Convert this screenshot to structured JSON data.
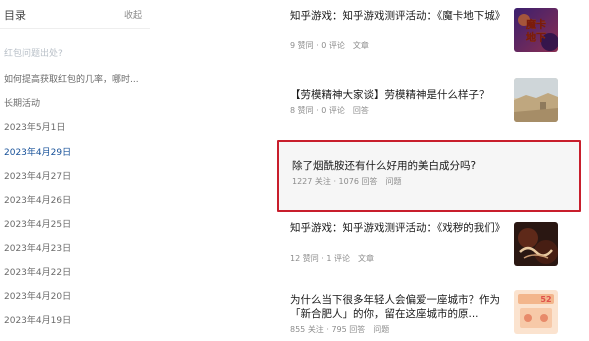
{
  "toc": {
    "title": "目录",
    "collapse_label": "收起",
    "items": [
      {
        "label": "红包问题出处?",
        "state": "faded"
      },
      {
        "label": "如何提高获取红包的几率，哪时...",
        "state": "normal"
      },
      {
        "label": "长期活动",
        "state": "normal"
      },
      {
        "label": "2023年5月1日",
        "state": "normal"
      },
      {
        "label": "2023年4月29日",
        "state": "active"
      },
      {
        "label": "2023年4月27日",
        "state": "normal"
      },
      {
        "label": "2023年4月26日",
        "state": "normal"
      },
      {
        "label": "2023年4月25日",
        "state": "normal"
      },
      {
        "label": "2023年4月23日",
        "state": "normal"
      },
      {
        "label": "2023年4月22日",
        "state": "normal"
      },
      {
        "label": "2023年4月20日",
        "state": "normal"
      },
      {
        "label": "2023年4月19日",
        "state": "normal"
      }
    ]
  },
  "feed": {
    "cards": [
      {
        "title": "知乎游戏：知乎游戏测评活动：《魔卡地下城》",
        "stat1": "9 赞同",
        "stat2": "0 评论",
        "tag": "文章",
        "thumb": "魔卡地下"
      },
      {
        "title": "【劳模精神大家谈】劳模精神是什么样子？",
        "stat1": "8 赞同",
        "stat2": "0 评论",
        "tag": "回答",
        "thumb": ""
      },
      {
        "title": "除了烟酰胺还有什么好用的美白成分吗?",
        "stat1": "1227 关注",
        "stat2": "1076 回答",
        "tag": "问题",
        "thumb": ""
      },
      {
        "title": "知乎游戏：知乎游戏测评活动：《戏秽的我们》",
        "stat1": "12 赞同",
        "stat2": "1 评论",
        "tag": "文章",
        "thumb": ""
      },
      {
        "title": "为什么当下很多年轻人会偏爱一座城市？作为「新合肥人」的你，留在这座城市的原...",
        "stat1": "855 关注",
        "stat2": "795 回答",
        "tag": "问题",
        "thumb": "52"
      }
    ]
  },
  "colors": {
    "highlight_border": "#c81e2c",
    "active_link": "#175199"
  }
}
